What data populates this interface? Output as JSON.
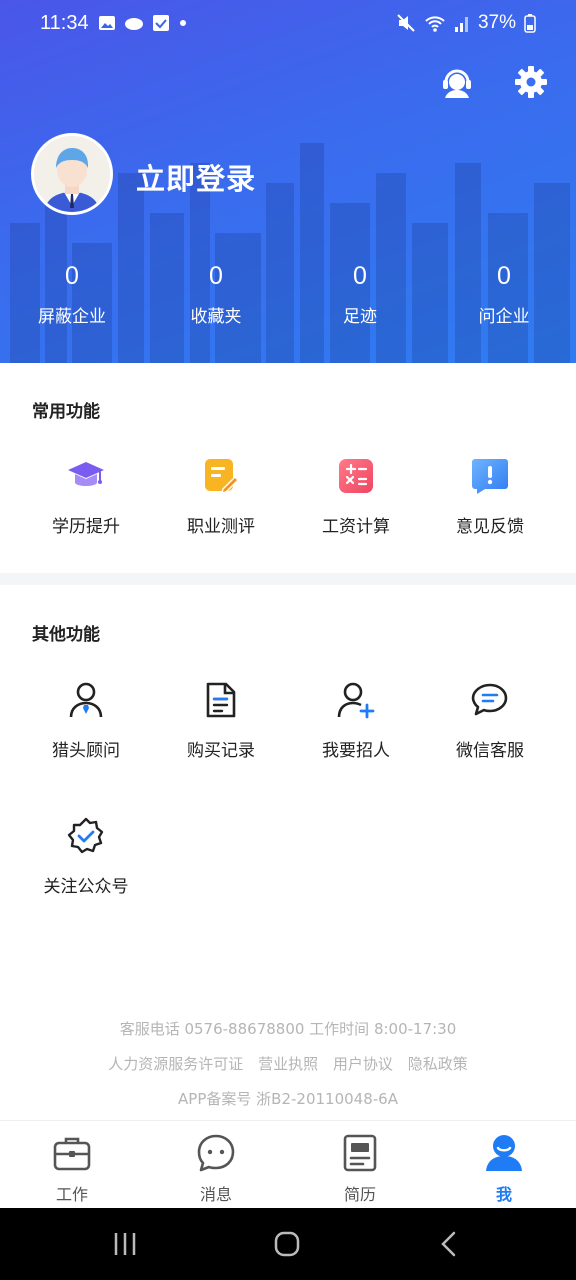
{
  "status": {
    "time": "11:34",
    "battery": "37%"
  },
  "header": {
    "login_label": "立即登录"
  },
  "stats": [
    {
      "value": "0",
      "label": "屏蔽企业"
    },
    {
      "value": "0",
      "label": "收藏夹"
    },
    {
      "value": "0",
      "label": "足迹"
    },
    {
      "value": "0",
      "label": "问企业"
    }
  ],
  "common": {
    "title": "常用功能",
    "items": [
      {
        "label": "学历提升",
        "icon": "graduation-cap-icon"
      },
      {
        "label": "职业测评",
        "icon": "assessment-icon"
      },
      {
        "label": "工资计算",
        "icon": "calculator-icon"
      },
      {
        "label": "意见反馈",
        "icon": "feedback-icon"
      }
    ]
  },
  "other": {
    "title": "其他功能",
    "items": [
      {
        "label": "猎头顾问",
        "icon": "headhunter-icon"
      },
      {
        "label": "购买记录",
        "icon": "document-icon"
      },
      {
        "label": "我要招人",
        "icon": "add-user-icon"
      },
      {
        "label": "微信客服",
        "icon": "chat-icon"
      },
      {
        "label": "关注公众号",
        "icon": "verified-badge-icon"
      }
    ]
  },
  "footer": {
    "contact": "客服电话 0576-88678800 工作时间 8:00-17:30",
    "links": [
      "人力资源服务许可证",
      "营业执照",
      "用户协议",
      "隐私政策"
    ],
    "record": "APP备案号 浙B2-20110048-6A"
  },
  "tabs": [
    {
      "label": "工作",
      "icon": "briefcase-icon",
      "active": false
    },
    {
      "label": "消息",
      "icon": "message-icon",
      "active": false
    },
    {
      "label": "简历",
      "icon": "resume-icon",
      "active": false
    },
    {
      "label": "我",
      "icon": "profile-icon",
      "active": true
    }
  ],
  "colors": {
    "accent": "#1f7cf5",
    "header_start": "#4a56e8",
    "header_end": "#2f7cf2"
  }
}
